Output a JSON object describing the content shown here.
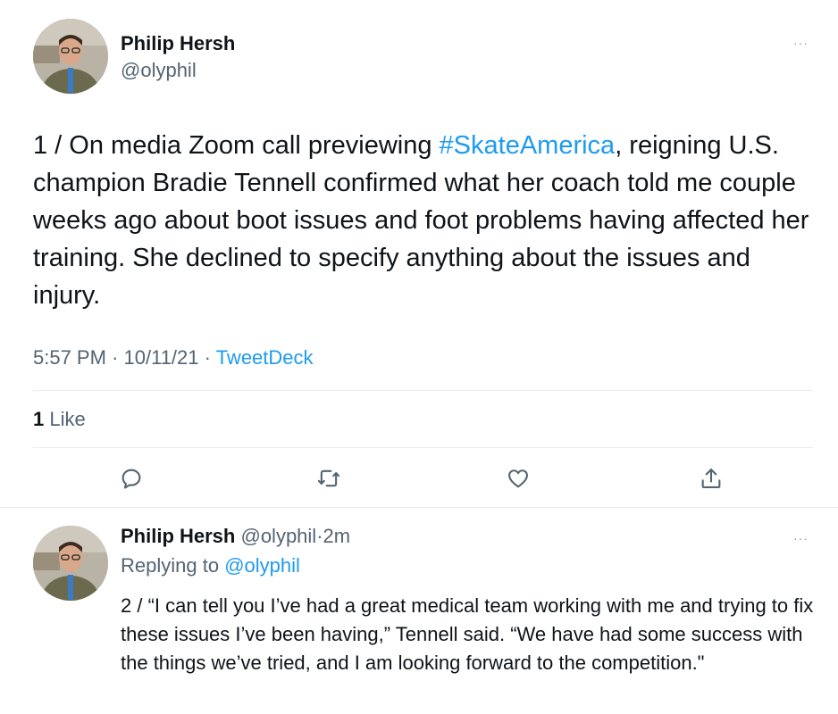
{
  "main_tweet": {
    "author_name": "Philip Hersh",
    "author_handle": "@olyphil",
    "more_label": "···",
    "text_before": "1 / On media Zoom call previewing ",
    "hashtag": "#SkateAmerica",
    "text_after": ", reigning U.S. champion Bradie Tennell confirmed what her coach told me couple weeks ago about boot issues and foot problems having affected her training.  She declined to specify anything about the issues and injury.",
    "time": "5:57 PM",
    "separator": "·",
    "date": "10/11/21",
    "source": "TweetDeck",
    "likes_count": "1",
    "likes_label": "Like",
    "actions": [
      "comment-icon",
      "retweet-icon",
      "heart-icon",
      "share-icon"
    ]
  },
  "reply_tweet": {
    "author_name": "Philip Hersh",
    "author_handle": "@olyphil",
    "separator": "·",
    "time_ago": "2m",
    "more_label": "···",
    "replying_label": "Replying to",
    "replying_to": "@olyphil",
    "text": "2 / “I can tell you I’ve had a great medical team working with me and trying to fix these issues I’ve been having,” Tennell said.  “We have had some success with the things we’ve tried, and I am looking forward to the competition.\""
  },
  "colors": {
    "link": "#1d9bf0",
    "secondary_text": "#536471",
    "primary_text": "#0f1419",
    "divider": "#e6ecf0"
  }
}
